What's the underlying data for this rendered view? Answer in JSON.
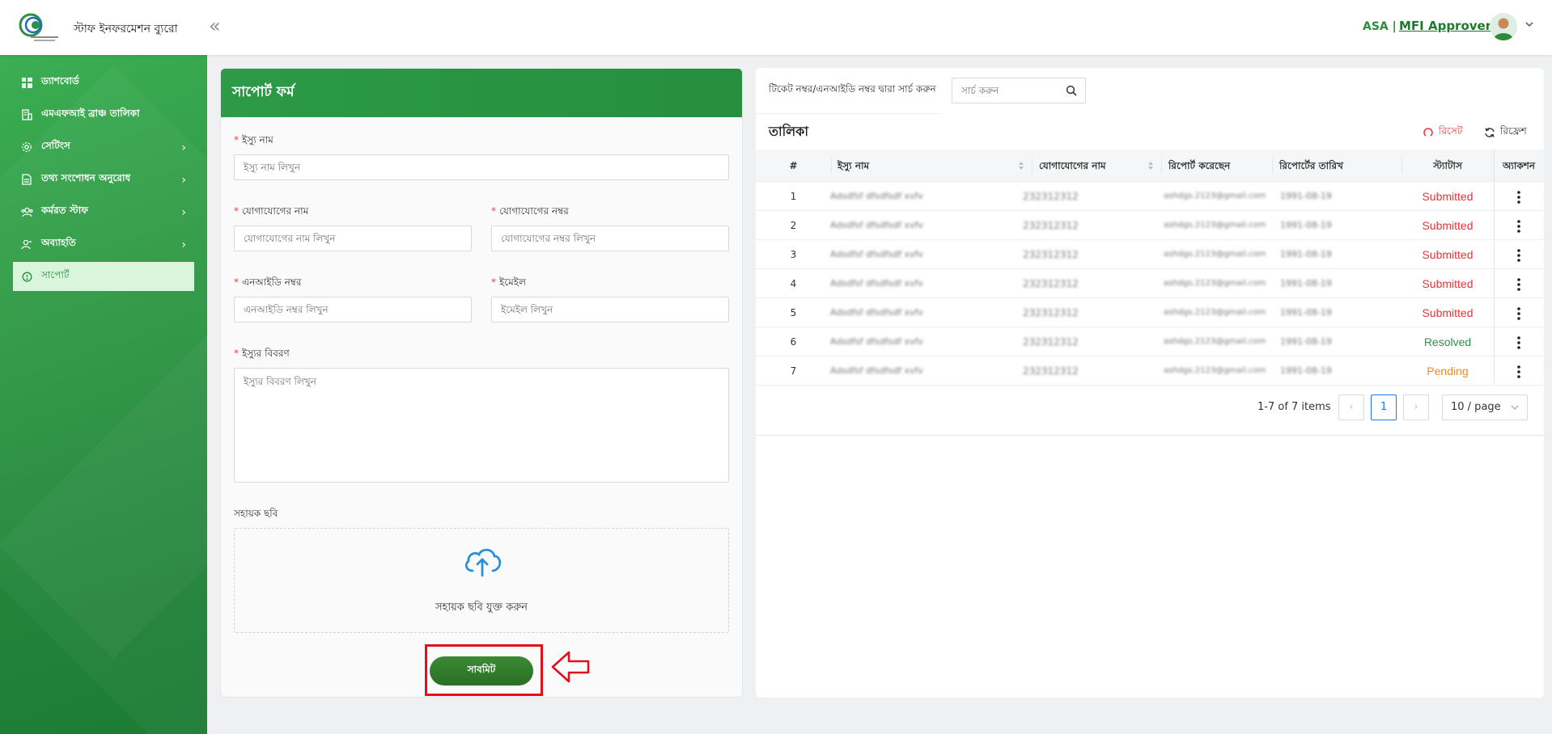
{
  "header": {
    "app_title": "স্টাফ ইনফরমেশন ব্যুরো",
    "org": "ASA |",
    "role": "MFI Approver"
  },
  "sidebar": {
    "items": [
      {
        "label": "ড্যাশবোর্ড",
        "icon": "dashboard-icon",
        "has_children": false,
        "active": false
      },
      {
        "label": "এমএফআই ব্রাঞ্চ তালিকা",
        "icon": "building-icon",
        "has_children": false,
        "active": false
      },
      {
        "label": "সেটিংস",
        "icon": "gear-icon",
        "has_children": true,
        "active": false
      },
      {
        "label": "তথ্য সংশোধন অনুরোধ",
        "icon": "document-icon",
        "has_children": true,
        "active": false
      },
      {
        "label": "কর্মরত স্টাফ",
        "icon": "users-icon",
        "has_children": true,
        "active": false
      },
      {
        "label": "অব্যাহতি",
        "icon": "user-remove-icon",
        "has_children": true,
        "active": false
      },
      {
        "label": "সাপোর্ট",
        "icon": "support-icon",
        "has_children": false,
        "active": true
      }
    ]
  },
  "form": {
    "title": "সাপোর্ট ফর্ম",
    "issue_name_label": "ইস্যু নাম",
    "issue_name_placeholder": "ইস্যু নাম লিখুন",
    "contact_name_label": "যোগাযোগের নাম",
    "contact_name_placeholder": "যোগাযোগের নাম লিখুন",
    "contact_number_label": "যোগাযোগের নম্বর",
    "contact_number_placeholder": "যোগাযোগের নম্বর লিখুন",
    "nid_label": "এনআইডি নম্বর",
    "nid_placeholder": "এনআইডি নম্বর লিখুন",
    "email_label": "ইমেইল",
    "email_placeholder": "ইমেইল লিখুন",
    "description_label": "ইস্যুর বিবরণ",
    "description_placeholder": "ইস্যুর বিবরণ লিখুন",
    "image_label": "সহায়ক ছবি",
    "upload_text": "সহায়ক ছবি যুক্ত করুন",
    "submit_label": "সাবমিট",
    "required_mark": "*"
  },
  "table_panel": {
    "search_label": "টিকেট নম্বর/এনআইডি নম্বর দ্বারা সার্চ করুন",
    "search_placeholder": "সার্চ করুন",
    "title": "তালিকা",
    "reset_label": "রিসেট",
    "refresh_label": "রিফ্রেশ",
    "columns": [
      "#",
      "ইস্যু নাম",
      "যোগাযোগের নাম",
      "রিপোর্ট করেছেন",
      "রিপোর্টের তারিখ",
      "স্ট্যাটাস",
      "অ্যাকশন"
    ],
    "rows": [
      {
        "no": "1",
        "issue": "Adsdfsf dfsdfsdf xvfv",
        "contact": "232312312",
        "reporter": "ashdgs.2123@gmail.com",
        "date": "1991-08-19",
        "status": "Submitted",
        "status_color": "#e0363b"
      },
      {
        "no": "2",
        "issue": "Adsdfsf dfsdfsdf xvfv",
        "contact": "232312312",
        "reporter": "ashdgs.2123@gmail.com",
        "date": "1991-08-19",
        "status": "Submitted",
        "status_color": "#e0363b"
      },
      {
        "no": "3",
        "issue": "Adsdfsf dfsdfsdf xvfv",
        "contact": "232312312",
        "reporter": "ashdgs.2123@gmail.com",
        "date": "1991-08-19",
        "status": "Submitted",
        "status_color": "#e0363b"
      },
      {
        "no": "4",
        "issue": "Adsdfsf dfsdfsdf xvfv",
        "contact": "232312312",
        "reporter": "ashdgs.2123@gmail.com",
        "date": "1991-08-19",
        "status": "Submitted",
        "status_color": "#e0363b"
      },
      {
        "no": "5",
        "issue": "Adsdfsf dfsdfsdf xvfv",
        "contact": "232312312",
        "reporter": "ashdgs.2123@gmail.com",
        "date": "1991-08-19",
        "status": "Submitted",
        "status_color": "#e0363b"
      },
      {
        "no": "6",
        "issue": "Adsdfsf dfsdfsdf xvfv",
        "contact": "232312312",
        "reporter": "ashdgs.2123@gmail.com",
        "date": "1991-08-19",
        "status": "Resolved",
        "status_color": "#2f8f46"
      },
      {
        "no": "7",
        "issue": "Adsdfsf dfsdfsdf xvfv",
        "contact": "232312312",
        "reporter": "ashdgs.2123@gmail.com",
        "date": "1991-08-19",
        "status": "Pending",
        "status_color": "#f08a24"
      }
    ],
    "pagination": {
      "summary": "1-7 of 7 items",
      "current_page": "1",
      "page_size": "10 / page"
    }
  },
  "colors": {
    "brand_green": "#2c9a47",
    "reset_red": "#e0363b",
    "annotation_red": "#e3101a"
  }
}
